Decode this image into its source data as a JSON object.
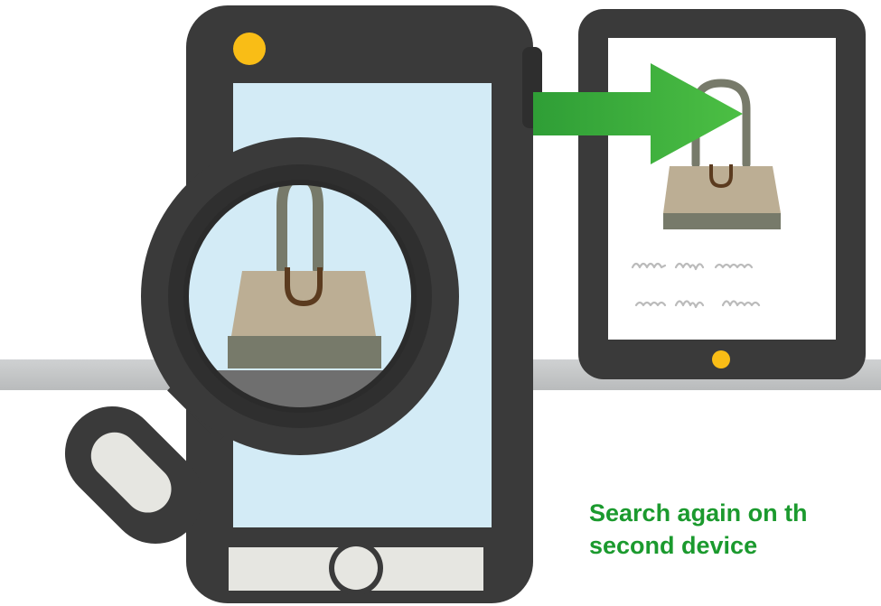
{
  "caption": {
    "line1": "Search again on th",
    "line2": "second device"
  },
  "icons": {
    "phone": "smartphone-icon",
    "tablet": "tablet-icon",
    "magnifier": "magnifying-glass-icon",
    "arrow": "arrow-right-icon",
    "bag": "handbag-icon"
  },
  "colors": {
    "device_frame": "#3a3a3a",
    "phone_screen": "#d3ebf6",
    "accent_yellow": "#f9bd16",
    "arrow_green": "#35a93c",
    "bag_body": "#bcae94",
    "bag_bottom": "#777a6a",
    "caption_text": "#1b9a2e"
  }
}
